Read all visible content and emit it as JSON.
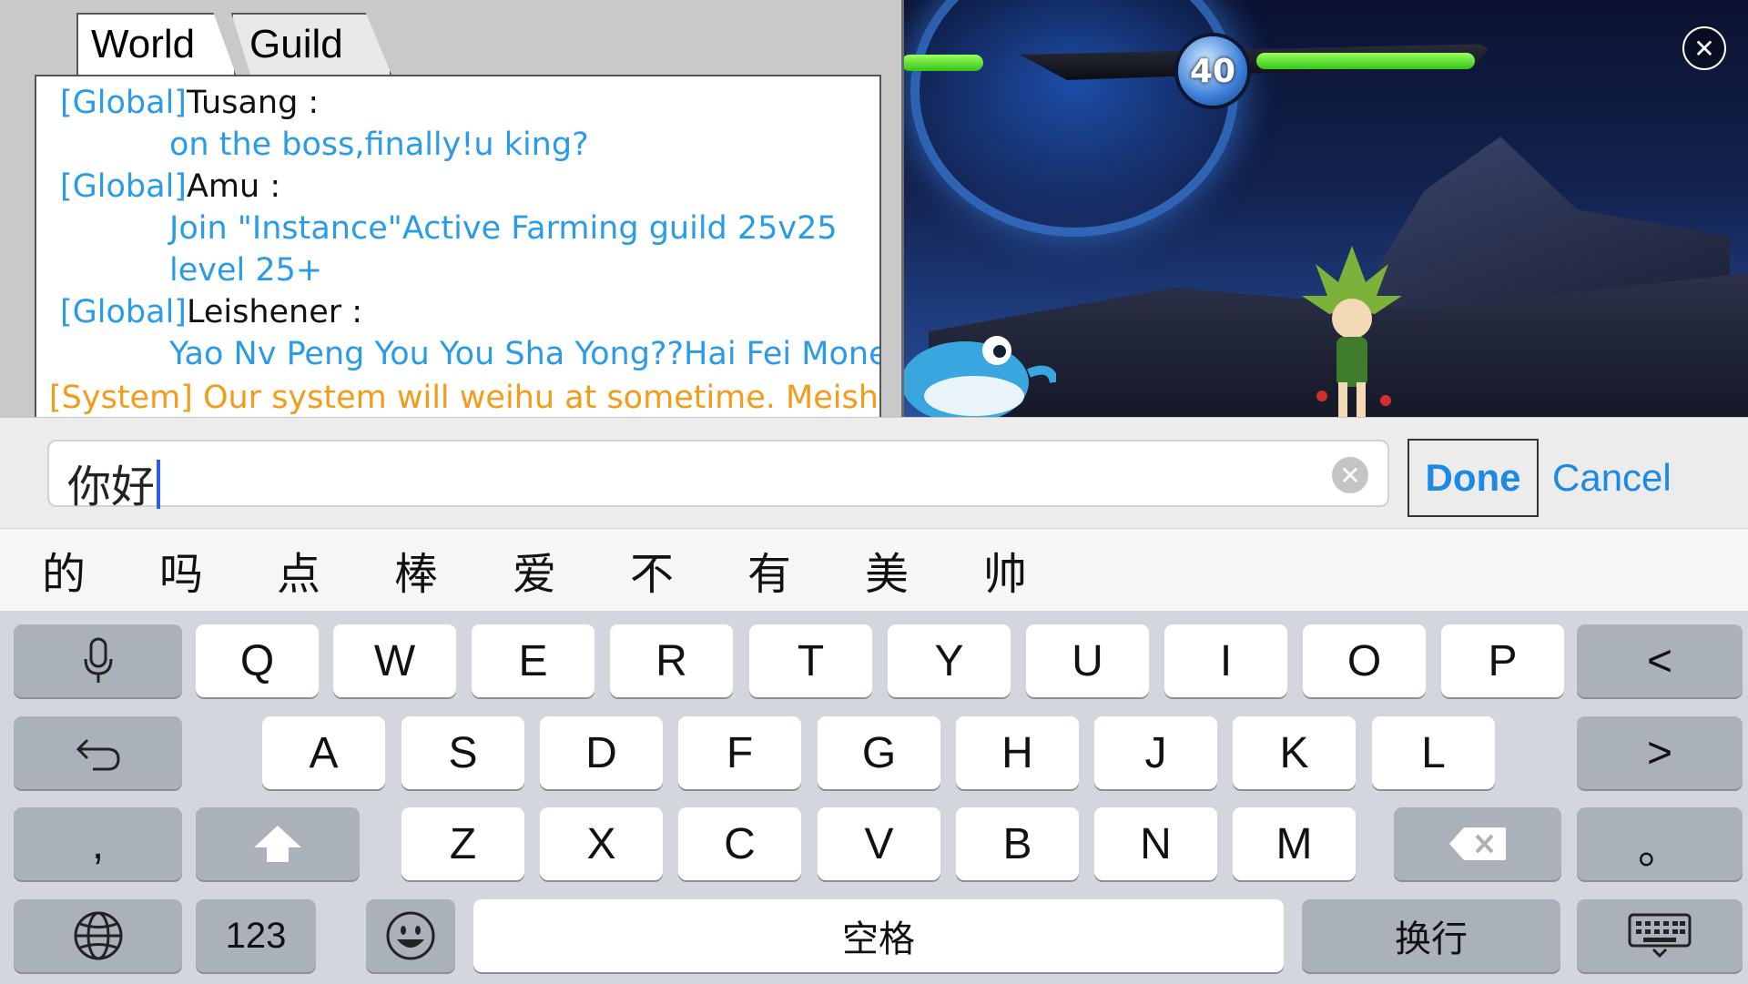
{
  "game": {
    "level": "40",
    "icons": {
      "close": "close-icon"
    }
  },
  "chat": {
    "tabs": [
      "World",
      "Guild"
    ],
    "messages": [
      {
        "channel": "[Global]",
        "sender": "Tusang :",
        "body": "on the boss,finally!u king?"
      },
      {
        "channel": "[Global]",
        "sender": "Amu :",
        "body": "Join \"Instance\"Active Farming guild 25v25 level 25+"
      },
      {
        "channel": "[Global]",
        "sender": "Leishener :",
        "body": "Yao Nv Peng You You Sha Yong??Hai Fei Money"
      }
    ],
    "system_message": "[System] Our system will weihu at sometime. Meishi de"
  },
  "input": {
    "value": "你好",
    "done_label": "Done",
    "cancel_label": "Cancel",
    "clear_icon": "clear-icon"
  },
  "candidates": [
    "的",
    "吗",
    "点",
    "棒",
    "爱",
    "不",
    "有",
    "美",
    "帅"
  ],
  "keyboard": {
    "row1": [
      "Q",
      "W",
      "E",
      "R",
      "T",
      "Y",
      "U",
      "I",
      "O",
      "P"
    ],
    "row2": [
      "A",
      "S",
      "D",
      "F",
      "G",
      "H",
      "J",
      "K",
      "L"
    ],
    "row3": [
      "Z",
      "X",
      "C",
      "V",
      "B",
      "N",
      "M"
    ],
    "left_arrow": "<",
    "right_arrow": ">",
    "comma": ",",
    "period": "。",
    "numbers_label": "123",
    "space_label": "空格",
    "return_label": "换行",
    "icons": {
      "mic": "microphone-icon",
      "undo": "undo-icon",
      "shift": "shift-icon",
      "delete": "delete-icon",
      "globe": "globe-icon",
      "emoji": "emoji-icon",
      "dismiss": "keyboard-dismiss-icon"
    }
  }
}
